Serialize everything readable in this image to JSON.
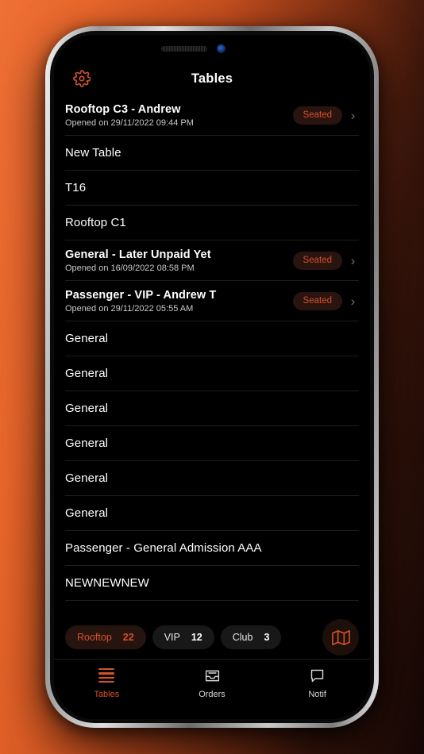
{
  "header": {
    "title": "Tables",
    "settings_icon": "gear-icon"
  },
  "colors": {
    "accent": "#d4512a",
    "background_orange": "#e8662a",
    "screen_black": "#000000",
    "badge_bg": "#2a1410",
    "chip_bg": "#181818",
    "chip_active_bg": "#26140e",
    "divider": "#1d1d1d"
  },
  "table_list": [
    {
      "title": "Rooftop C3 - Andrew",
      "subtitle": "Opened on 29/11/2022 09:44 PM",
      "status": "Seated",
      "chevron": "›"
    },
    {
      "title": "New Table",
      "subtitle": "",
      "status": "",
      "chevron": ""
    },
    {
      "title": "T16",
      "subtitle": "",
      "status": "",
      "chevron": ""
    },
    {
      "title": "Rooftop C1",
      "subtitle": "",
      "status": "",
      "chevron": ""
    },
    {
      "title": "General - Later Unpaid Yet",
      "subtitle": "Opened on 16/09/2022 08:58 PM",
      "status": "Seated",
      "chevron": "›"
    },
    {
      "title": "Passenger - VIP - Andrew T",
      "subtitle": "Opened on 29/11/2022 05:55 AM",
      "status": "Seated",
      "chevron": "›"
    },
    {
      "title": "General",
      "subtitle": "",
      "status": "",
      "chevron": ""
    },
    {
      "title": "General",
      "subtitle": "",
      "status": "",
      "chevron": ""
    },
    {
      "title": "General",
      "subtitle": "",
      "status": "",
      "chevron": ""
    },
    {
      "title": "General",
      "subtitle": "",
      "status": "",
      "chevron": ""
    },
    {
      "title": "General",
      "subtitle": "",
      "status": "",
      "chevron": ""
    },
    {
      "title": "General",
      "subtitle": "",
      "status": "",
      "chevron": ""
    },
    {
      "title": "Passenger - General Admission AAA",
      "subtitle": "",
      "status": "",
      "chevron": ""
    },
    {
      "title": "NEWNEWNEW",
      "subtitle": "",
      "status": "",
      "chevron": ""
    }
  ],
  "filters": {
    "chips": [
      {
        "label": "Rooftop",
        "count": "22",
        "active": true
      },
      {
        "label": "VIP",
        "count": "12",
        "active": false
      },
      {
        "label": "Club",
        "count": "3",
        "active": false
      }
    ],
    "map_button_icon": "map-icon"
  },
  "tabs": [
    {
      "label": "Tables",
      "icon": "hamburger-menu-icon",
      "active": true
    },
    {
      "label": "Orders",
      "icon": "inbox-tray-icon",
      "active": false
    },
    {
      "label": "Notif",
      "icon": "speech-bubble-icon",
      "active": false
    }
  ]
}
